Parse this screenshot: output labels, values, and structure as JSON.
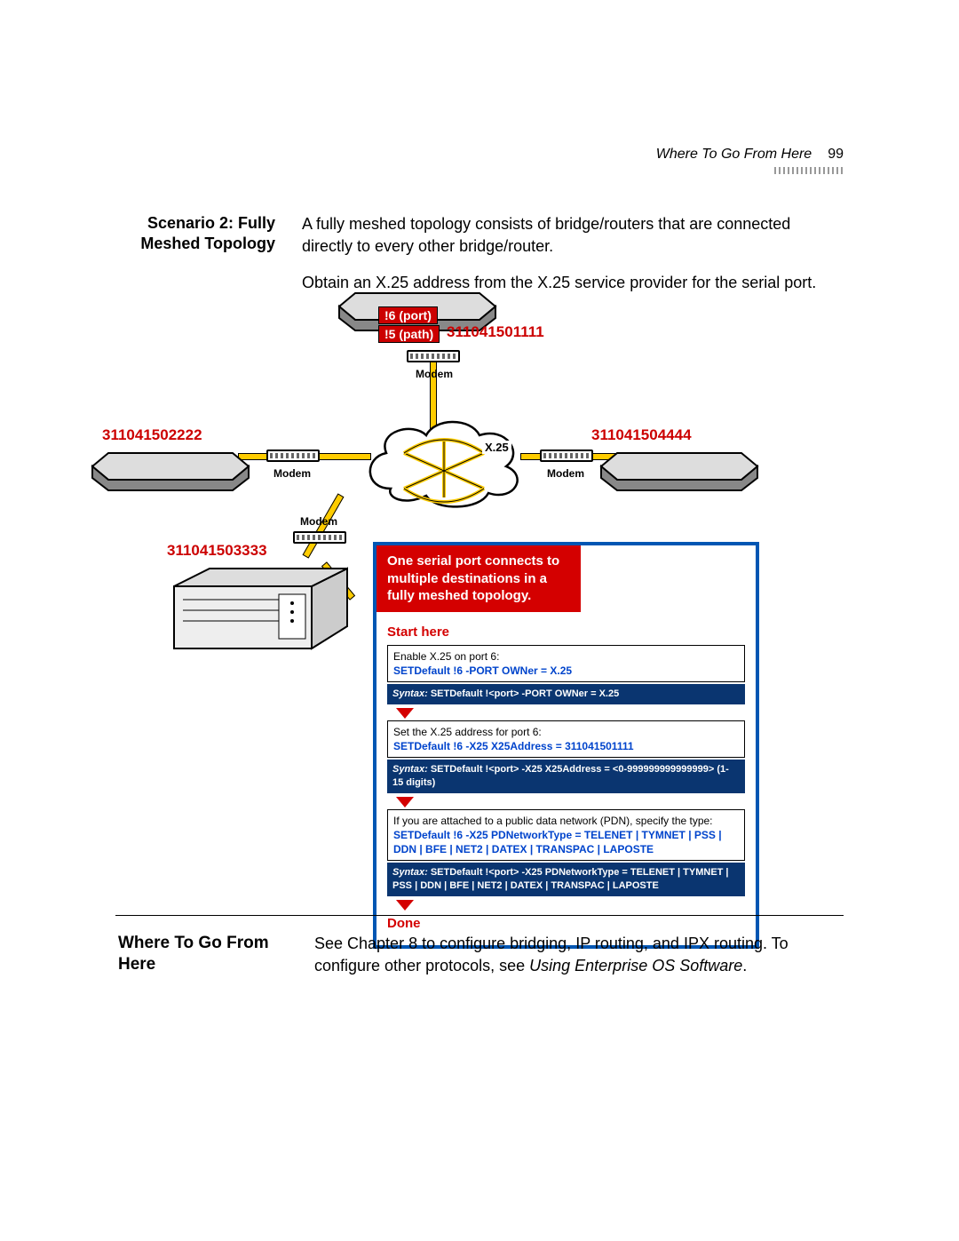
{
  "header": {
    "running_title": "Where To Go From Here",
    "page_number": "99"
  },
  "scenario": {
    "title": "Scenario 2: Fully Meshed Topology",
    "para1": "A fully meshed topology consists of bridge/routers that are connected directly to every other bridge/router.",
    "para2": "Obtain an X.25 address from the X.25 service provider for the serial port."
  },
  "diagram": {
    "port_label": "!6 (port)",
    "path_label": "!5 (path)",
    "addr_top": "311041501111",
    "addr_left": "311041502222",
    "addr_right": "311041504444",
    "addr_bottom": "311041503333",
    "modem_label": "Modem",
    "cloud_label": "X.25",
    "callout": {
      "header": "One serial port connects to multiple destinations in a fully meshed topology.",
      "start": "Start here",
      "step1_text": "Enable X.25 on port 6:",
      "step1_cmd": "SETDefault !6 -PORT OWNer = X.25",
      "syntax1": "SETDefault !<port> -PORT OWNer = X.25",
      "step2_text": "Set the X.25 address for port 6:",
      "step2_cmd": "SETDefault !6 -X25 X25Address = 311041501111",
      "syntax2": "SETDefault !<port> -X25 X25Address = <0-999999999999999> (1-15 digits)",
      "step3_text": "If you are attached to a public data network (PDN), specify the type:",
      "step3_cmd": "SETDefault !6 -X25 PDNetworkType = TELENET | TYMNET | PSS | DDN | BFE | NET2 | DATEX | TRANSPAC | LAPOSTE",
      "syntax3": "SETDefault !<port> -X25 PDNetworkType = TELENET | TYMNET | PSS | DDN | BFE | NET2 | DATEX | TRANSPAC | LAPOSTE",
      "syntax_label": "Syntax:",
      "done": "Done"
    }
  },
  "footer_section": {
    "title": "Where To Go From Here",
    "body_pre": "See Chapter 8 to configure bridging, IP routing, and IPX routing. To configure other protocols, see ",
    "body_ital": "Using Enterprise OS Software",
    "body_post": "."
  }
}
